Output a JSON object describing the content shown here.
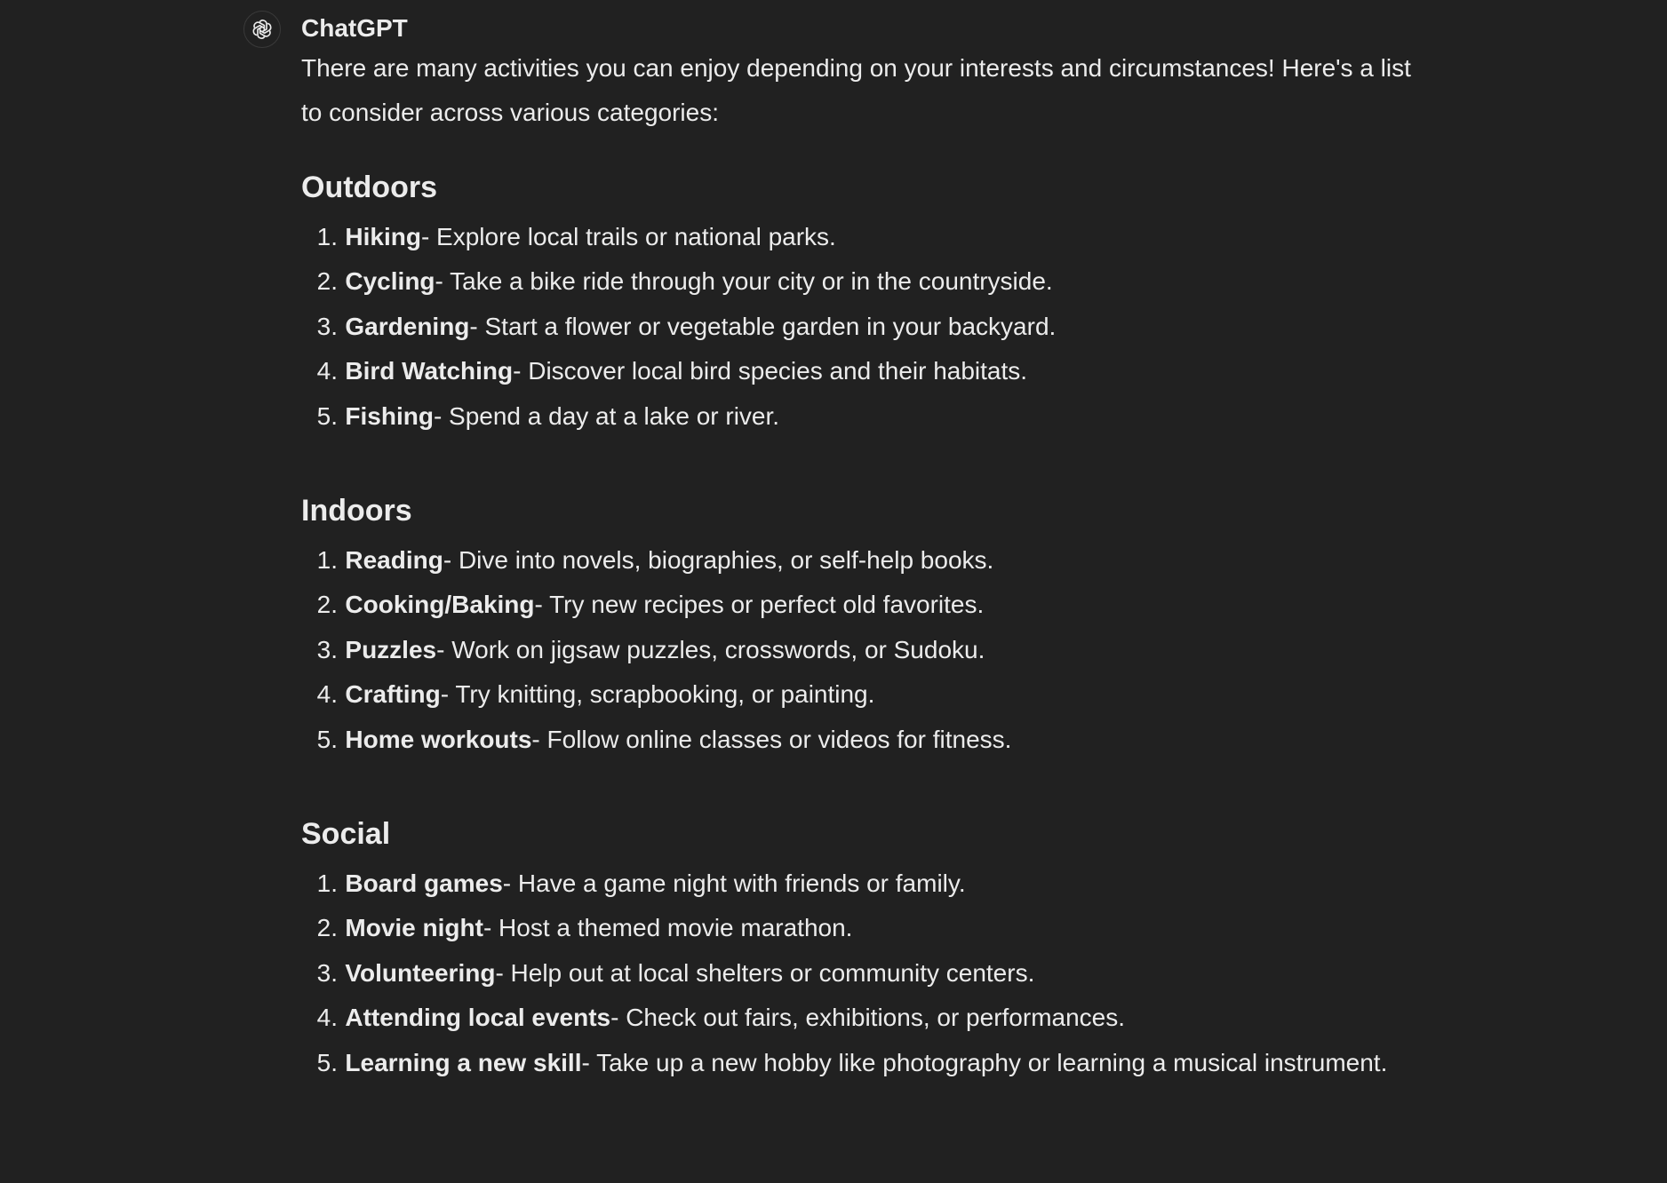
{
  "message": {
    "author": "ChatGPT",
    "intro": "There are many activities you can enjoy depending on your interests and circumstances! Here's a list to consider across various categories:",
    "avatar_icon": "openai-logo-icon",
    "sections": [
      {
        "title": "Outdoors",
        "items": [
          {
            "num": "1.",
            "term": "Hiking",
            "desc": " - Explore local trails or national parks."
          },
          {
            "num": "2.",
            "term": "Cycling",
            "desc": " - Take a bike ride through your city or in the countryside."
          },
          {
            "num": "3.",
            "term": "Gardening",
            "desc": " - Start a flower or vegetable garden in your backyard."
          },
          {
            "num": "4.",
            "term": "Bird Watching",
            "desc": " - Discover local bird species and their habitats."
          },
          {
            "num": "5.",
            "term": "Fishing",
            "desc": " - Spend a day at a lake or river."
          }
        ]
      },
      {
        "title": "Indoors",
        "items": [
          {
            "num": "1.",
            "term": "Reading",
            "desc": " - Dive into novels, biographies, or self-help books."
          },
          {
            "num": "2.",
            "term": "Cooking/Baking",
            "desc": " - Try new recipes or perfect old favorites."
          },
          {
            "num": "3.",
            "term": "Puzzles",
            "desc": " - Work on jigsaw puzzles, crosswords, or Sudoku."
          },
          {
            "num": "4.",
            "term": "Crafting",
            "desc": " - Try knitting, scrapbooking, or painting."
          },
          {
            "num": "5.",
            "term": "Home workouts",
            "desc": " - Follow online classes or videos for fitness."
          }
        ]
      },
      {
        "title": "Social",
        "items": [
          {
            "num": "1.",
            "term": "Board games",
            "desc": " - Have a game night with friends or family."
          },
          {
            "num": "2.",
            "term": "Movie night",
            "desc": " - Host a themed movie marathon."
          },
          {
            "num": "3.",
            "term": "Volunteering",
            "desc": " - Help out at local shelters or community centers."
          },
          {
            "num": "4.",
            "term": "Attending local events",
            "desc": " - Check out fairs, exhibitions, or performances."
          },
          {
            "num": "5.",
            "term": "Learning a new skill",
            "desc": " - Take up a new hobby like photography or learning a musical instrument."
          }
        ]
      }
    ]
  },
  "colors": {
    "background": "#212121",
    "text": "#ececec"
  }
}
